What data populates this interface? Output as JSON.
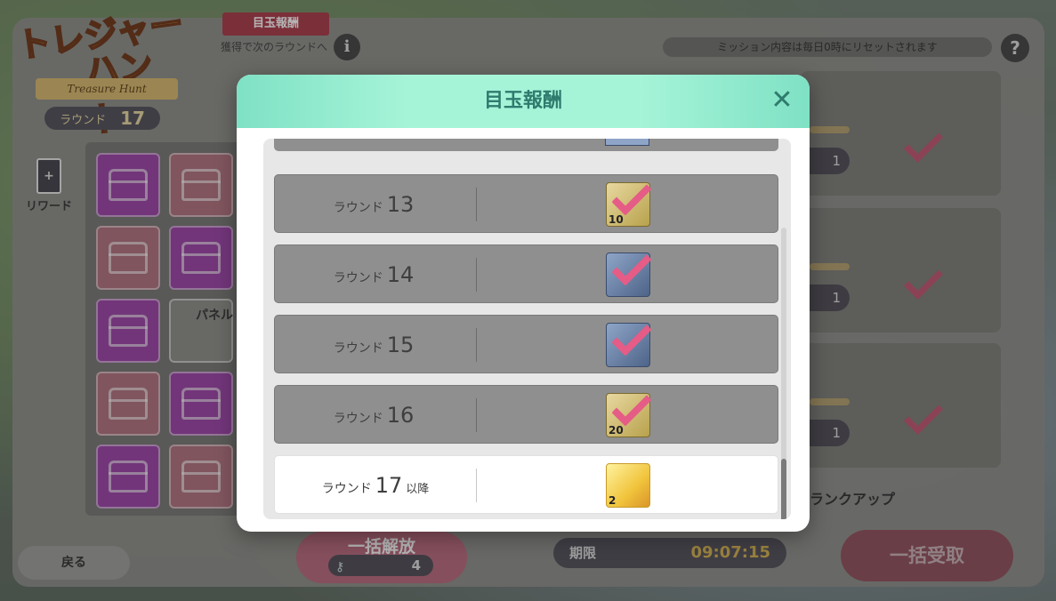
{
  "game": {
    "logo_line1": "トレジャー",
    "logo_line2": "ハント",
    "logo_sub": "Treasure Hunt",
    "round_label": "ラウンド",
    "round_value": "17",
    "reward_label": "リワード",
    "reward_icon_text": "+",
    "panel_label": "パネル",
    "mark_tag": "目玉報酬",
    "next_round_text": "獲得で次のラウンドへ",
    "info_glyph": "i",
    "help_glyph": "?",
    "mission_note": "ミッション内容は毎日0時にリセットされます",
    "mission_counts": [
      "1",
      "1",
      "1"
    ],
    "rank_up": "ランクアップ",
    "back": "戻る",
    "bulk_open": "一括解放",
    "key_count": "4",
    "deadline_label": "期限",
    "deadline_time": "09:07:15",
    "bulk_claim": "一括受取"
  },
  "modal": {
    "title": "目玉報酬",
    "close_glyph": "✕",
    "rows": [
      {
        "prefix": "ラウンド",
        "round": "13",
        "suffix": "",
        "item": "gold-ticket",
        "qty": "10",
        "claimed": true
      },
      {
        "prefix": "ラウンド",
        "round": "14",
        "suffix": "",
        "item": "blue-badge",
        "qty": "",
        "claimed": true
      },
      {
        "prefix": "ラウンド",
        "round": "15",
        "suffix": "",
        "item": "blue-badge",
        "qty": "",
        "claimed": true
      },
      {
        "prefix": "ラウンド",
        "round": "16",
        "suffix": "",
        "item": "gold-ticket",
        "qty": "20",
        "claimed": true
      },
      {
        "prefix": "ラウンド",
        "round": "17",
        "suffix": "以降",
        "item": "gacha-ticket",
        "qty": "2",
        "claimed": false
      }
    ]
  },
  "colors": {
    "accent": "#a6f4d8",
    "title_text": "#2f7b6e",
    "check": "#e55c86"
  }
}
